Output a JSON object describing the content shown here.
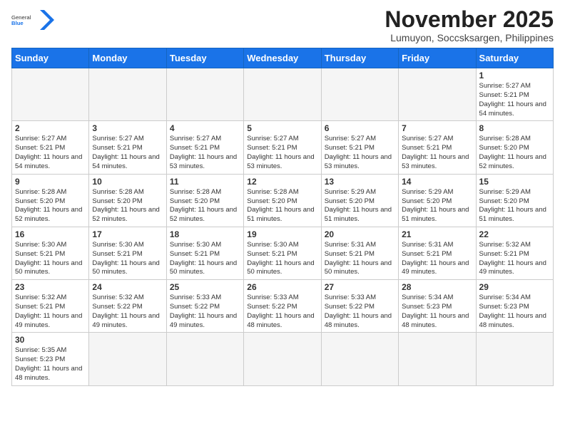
{
  "logo": {
    "general": "General",
    "blue": "Blue"
  },
  "title": {
    "month_year": "November 2025",
    "location": "Lumuyon, Soccsksargen, Philippines"
  },
  "days_of_week": [
    "Sunday",
    "Monday",
    "Tuesday",
    "Wednesday",
    "Thursday",
    "Friday",
    "Saturday"
  ],
  "weeks": [
    [
      {
        "day": "",
        "info": ""
      },
      {
        "day": "",
        "info": ""
      },
      {
        "day": "",
        "info": ""
      },
      {
        "day": "",
        "info": ""
      },
      {
        "day": "",
        "info": ""
      },
      {
        "day": "",
        "info": ""
      },
      {
        "day": "1",
        "info": "Sunrise: 5:27 AM\nSunset: 5:21 PM\nDaylight: 11 hours\nand 54 minutes."
      }
    ],
    [
      {
        "day": "2",
        "info": "Sunrise: 5:27 AM\nSunset: 5:21 PM\nDaylight: 11 hours\nand 54 minutes."
      },
      {
        "day": "3",
        "info": "Sunrise: 5:27 AM\nSunset: 5:21 PM\nDaylight: 11 hours\nand 54 minutes."
      },
      {
        "day": "4",
        "info": "Sunrise: 5:27 AM\nSunset: 5:21 PM\nDaylight: 11 hours\nand 53 minutes."
      },
      {
        "day": "5",
        "info": "Sunrise: 5:27 AM\nSunset: 5:21 PM\nDaylight: 11 hours\nand 53 minutes."
      },
      {
        "day": "6",
        "info": "Sunrise: 5:27 AM\nSunset: 5:21 PM\nDaylight: 11 hours\nand 53 minutes."
      },
      {
        "day": "7",
        "info": "Sunrise: 5:27 AM\nSunset: 5:21 PM\nDaylight: 11 hours\nand 53 minutes."
      },
      {
        "day": "8",
        "info": "Sunrise: 5:28 AM\nSunset: 5:20 PM\nDaylight: 11 hours\nand 52 minutes."
      }
    ],
    [
      {
        "day": "9",
        "info": "Sunrise: 5:28 AM\nSunset: 5:20 PM\nDaylight: 11 hours\nand 52 minutes."
      },
      {
        "day": "10",
        "info": "Sunrise: 5:28 AM\nSunset: 5:20 PM\nDaylight: 11 hours\nand 52 minutes."
      },
      {
        "day": "11",
        "info": "Sunrise: 5:28 AM\nSunset: 5:20 PM\nDaylight: 11 hours\nand 52 minutes."
      },
      {
        "day": "12",
        "info": "Sunrise: 5:28 AM\nSunset: 5:20 PM\nDaylight: 11 hours\nand 51 minutes."
      },
      {
        "day": "13",
        "info": "Sunrise: 5:29 AM\nSunset: 5:20 PM\nDaylight: 11 hours\nand 51 minutes."
      },
      {
        "day": "14",
        "info": "Sunrise: 5:29 AM\nSunset: 5:20 PM\nDaylight: 11 hours\nand 51 minutes."
      },
      {
        "day": "15",
        "info": "Sunrise: 5:29 AM\nSunset: 5:20 PM\nDaylight: 11 hours\nand 51 minutes."
      }
    ],
    [
      {
        "day": "16",
        "info": "Sunrise: 5:30 AM\nSunset: 5:21 PM\nDaylight: 11 hours\nand 50 minutes."
      },
      {
        "day": "17",
        "info": "Sunrise: 5:30 AM\nSunset: 5:21 PM\nDaylight: 11 hours\nand 50 minutes."
      },
      {
        "day": "18",
        "info": "Sunrise: 5:30 AM\nSunset: 5:21 PM\nDaylight: 11 hours\nand 50 minutes."
      },
      {
        "day": "19",
        "info": "Sunrise: 5:30 AM\nSunset: 5:21 PM\nDaylight: 11 hours\nand 50 minutes."
      },
      {
        "day": "20",
        "info": "Sunrise: 5:31 AM\nSunset: 5:21 PM\nDaylight: 11 hours\nand 50 minutes."
      },
      {
        "day": "21",
        "info": "Sunrise: 5:31 AM\nSunset: 5:21 PM\nDaylight: 11 hours\nand 49 minutes."
      },
      {
        "day": "22",
        "info": "Sunrise: 5:32 AM\nSunset: 5:21 PM\nDaylight: 11 hours\nand 49 minutes."
      }
    ],
    [
      {
        "day": "23",
        "info": "Sunrise: 5:32 AM\nSunset: 5:21 PM\nDaylight: 11 hours\nand 49 minutes."
      },
      {
        "day": "24",
        "info": "Sunrise: 5:32 AM\nSunset: 5:22 PM\nDaylight: 11 hours\nand 49 minutes."
      },
      {
        "day": "25",
        "info": "Sunrise: 5:33 AM\nSunset: 5:22 PM\nDaylight: 11 hours\nand 49 minutes."
      },
      {
        "day": "26",
        "info": "Sunrise: 5:33 AM\nSunset: 5:22 PM\nDaylight: 11 hours\nand 48 minutes."
      },
      {
        "day": "27",
        "info": "Sunrise: 5:33 AM\nSunset: 5:22 PM\nDaylight: 11 hours\nand 48 minutes."
      },
      {
        "day": "28",
        "info": "Sunrise: 5:34 AM\nSunset: 5:23 PM\nDaylight: 11 hours\nand 48 minutes."
      },
      {
        "day": "29",
        "info": "Sunrise: 5:34 AM\nSunset: 5:23 PM\nDaylight: 11 hours\nand 48 minutes."
      }
    ],
    [
      {
        "day": "30",
        "info": "Sunrise: 5:35 AM\nSunset: 5:23 PM\nDaylight: 11 hours\nand 48 minutes."
      },
      {
        "day": "",
        "info": ""
      },
      {
        "day": "",
        "info": ""
      },
      {
        "day": "",
        "info": ""
      },
      {
        "day": "",
        "info": ""
      },
      {
        "day": "",
        "info": ""
      },
      {
        "day": "",
        "info": ""
      }
    ]
  ]
}
